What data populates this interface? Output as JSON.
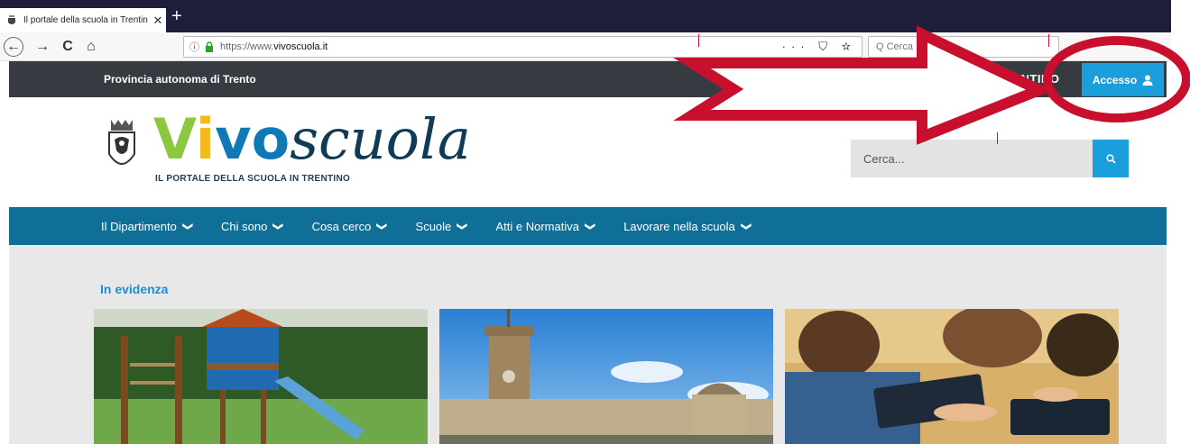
{
  "browser": {
    "tab_title": "Il portale della scuola in Trentin",
    "tab_close": "✕",
    "new_tab": "+",
    "nav": {
      "back": "←",
      "forward": "→",
      "reload": "C",
      "home": "⌂"
    },
    "url_info": "ⓘ",
    "url_prefix": "https://www.",
    "url_host": "vivoscuola.it",
    "url_actions": "··· ⛉ ☆",
    "search_placeholder": "Q Cerca"
  },
  "topbar": {
    "provincia": "Provincia autonoma di Trento",
    "brand": "TRENTINO",
    "access_label": "Accesso"
  },
  "header": {
    "logo_v": "V",
    "logo_i": "i",
    "logo_vo": "vo",
    "logo_rest": "scuola",
    "logo_subtitle": "IL PORTALE DELLA SCUOLA IN TRENTINO",
    "search_placeholder": "Cerca...",
    "search_button_icon": "search-icon"
  },
  "mainnav": {
    "items": [
      {
        "label": "Il Dipartimento",
        "chevron": "❯"
      },
      {
        "label": "Chi sono",
        "chevron": "❯"
      },
      {
        "label": "Cosa cerco",
        "chevron": "❯"
      },
      {
        "label": "Scuole",
        "chevron": "❯"
      },
      {
        "label": "Atti e Normativa",
        "chevron": "❯"
      },
      {
        "label": "Lavorare nella scuola",
        "chevron": "❯"
      }
    ]
  },
  "content": {
    "section_title": "In evidenza",
    "cards": [
      {
        "image": "playground-photo"
      },
      {
        "image": "trento-tower-photo"
      },
      {
        "image": "children-tablets-photo"
      }
    ]
  },
  "colors": {
    "accent_blue": "#1a9fdc",
    "nav_blue": "#106f96",
    "topbar_dark": "#353b41",
    "annotation_red": "#c8102e"
  }
}
